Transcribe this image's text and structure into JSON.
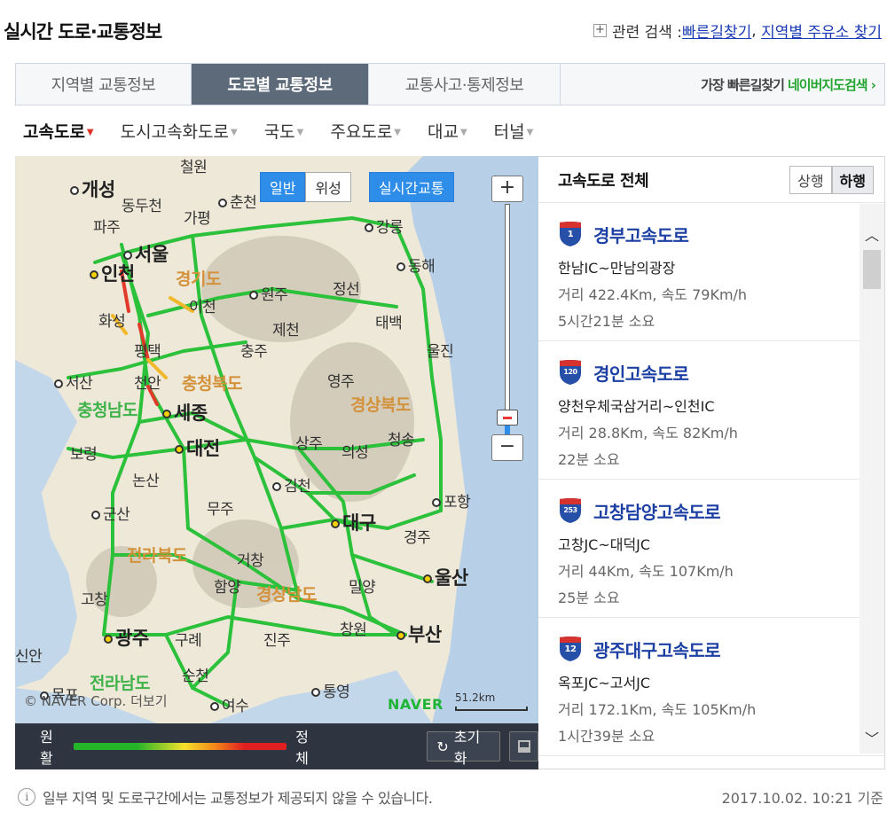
{
  "page": {
    "title": "실시간 도로·교통정보",
    "related_prefix": "관련 검색 : ",
    "related_links": [
      "빠른길찾기",
      "지역별 주유소 찾기"
    ]
  },
  "tabs": [
    {
      "label": "지역별 교통정보",
      "active": false
    },
    {
      "label": "도로별 교통정보",
      "active": true
    },
    {
      "label": "교통사고·통제정보",
      "active": false
    }
  ],
  "tab_right": {
    "text": "가장 빠른길찾기",
    "link": "네이버지도검색 ›"
  },
  "subnav": [
    {
      "label": "고속도로",
      "active": true
    },
    {
      "label": "도시고속화도로",
      "active": false
    },
    {
      "label": "국도",
      "active": false
    },
    {
      "label": "주요도로",
      "active": false
    },
    {
      "label": "대교",
      "active": false
    },
    {
      "label": "터널",
      "active": false
    }
  ],
  "map": {
    "type_buttons": [
      "일반",
      "위성"
    ],
    "traffic_button": "실시간교통",
    "zoom_in": "+",
    "zoom_out": "−",
    "labels": {
      "gaeseong": "개성",
      "seoul": "서울",
      "incheon": "인천",
      "chuncheon": "춘천",
      "gangneung": "강릉",
      "donghae": "동해",
      "wonju": "원주",
      "jeongseon": "정선",
      "icheon": "이천",
      "hwaseong": "화성",
      "pyeongtaek": "평택",
      "jecheon": "제천",
      "chungju": "충주",
      "taebaek": "태백",
      "uljin": "울진",
      "seosan": "서산",
      "cheonan": "천안",
      "sejong": "세종",
      "yeongju": "영주",
      "daejeon": "대전",
      "boryeong": "보령",
      "sangju": "상주",
      "uiseong": "의성",
      "cheongsong": "청송",
      "nonsan": "논산",
      "gimcheon": "김천",
      "pohang": "포항",
      "gunsan": "군산",
      "muju": "무주",
      "daegu": "대구",
      "gyeongju": "경주",
      "geochang": "거창",
      "ulsan": "울산",
      "gochang": "고창",
      "hamyang": "함양",
      "miryang": "밀양",
      "gwangju": "광주",
      "gurye": "구례",
      "jinju": "진주",
      "changwon": "창원",
      "busan": "부산",
      "sinan": "신안",
      "suncheon": "순천",
      "mokpo": "목포",
      "yeosu": "여수",
      "tongyeong": "통영",
      "paju": "파주",
      "dongducheon": "동두천",
      "gapyeong": "가평",
      "cheorwon": "철원"
    },
    "provinces": {
      "gyeonggi": "경기도",
      "chungbuk": "충청북도",
      "chungnam": "충청남도",
      "gyeongbuk": "경상북도",
      "jeonbuk": "전라북도",
      "gyeongnam": "경상남도",
      "jeonnam": "전라남도"
    },
    "copyright": "© NAVER Corp. 더보기",
    "logo": "NAVER",
    "scale": "51.2km"
  },
  "legend": {
    "smooth": "원활",
    "congested": "정체",
    "reset": "초기화"
  },
  "panel": {
    "title": "고속도로 전체",
    "directions": [
      {
        "label": "상행",
        "active": false
      },
      {
        "label": "하행",
        "active": true
      }
    ],
    "roads": [
      {
        "number": "1",
        "name": "경부고속도로",
        "section": "한남IC~만남의광장",
        "info": "거리 422.4Km, 속도 79Km/h",
        "time": "5시간21분 소요"
      },
      {
        "number": "120",
        "name": "경인고속도로",
        "section": "양천우체국삼거리~인천IC",
        "info": "거리 28.8Km, 속도 82Km/h",
        "time": "22분 소요"
      },
      {
        "number": "253",
        "name": "고창담양고속도로",
        "section": "고창JC~대덕JC",
        "info": "거리 44Km, 속도 107Km/h",
        "time": "25분 소요"
      },
      {
        "number": "12",
        "name": "광주대구고속도로",
        "section": "옥포JC~고서JC",
        "info": "거리 172.1Km, 속도 105Km/h",
        "time": "1시간39분 소요"
      }
    ]
  },
  "footer": {
    "note": "일부 지역 및 도로구간에서는 교통정보가 제공되지 않을 수 있습니다.",
    "timestamp": "2017.10.02. 10:21 기준"
  },
  "colors": {
    "active_tab": "#5d6a7a",
    "button_blue": "#2d8de8",
    "road_name": "#1c3fa3",
    "traffic_green": "#25b52a",
    "shield_red": "#d8322f",
    "shield_blue": "#2650a8"
  }
}
